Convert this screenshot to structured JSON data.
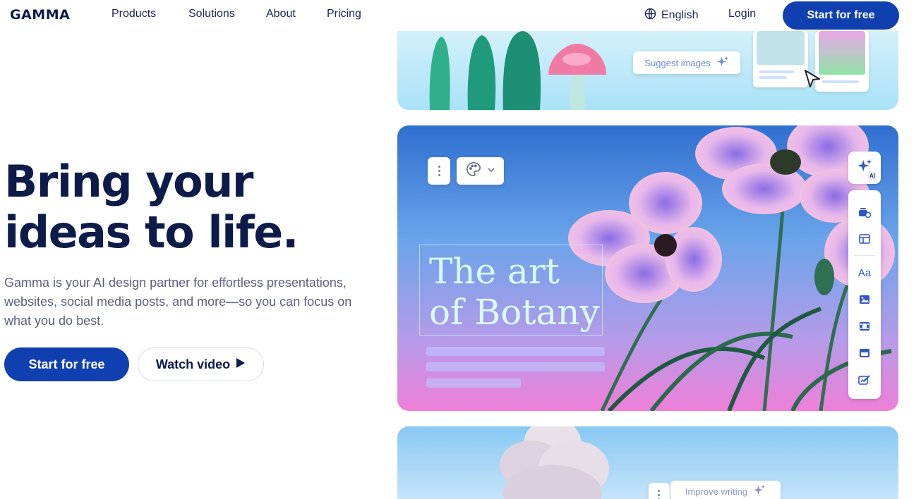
{
  "nav": {
    "logo": "GAMMA",
    "links": [
      "Products",
      "Solutions",
      "About",
      "Pricing"
    ],
    "language": "English",
    "login": "Login",
    "cta": "Start for free"
  },
  "hero": {
    "title_line1": "Bring your",
    "title_line2": "ideas to life.",
    "subtitle": "Gamma is your AI design partner for effortless presentations, websites, social media posts, and more—so you can focus on what you do best.",
    "primary_button": "Start for free",
    "secondary_button": "Watch video"
  },
  "showcase": {
    "suggest_chip": "Suggest images",
    "improve_chip": "Improve writing",
    "card_title_line1": "The art",
    "card_title_line2": "of Botany",
    "ai_badge": "AI",
    "toolbar_text_icon": "Aa"
  },
  "colors": {
    "brand": "#1040b0",
    "heading": "#0d1b4a",
    "body_text": "#5a5f7a",
    "toolbar_icon": "#2f57c9"
  },
  "icons": [
    "globe-icon",
    "play-icon",
    "sparkle-icon",
    "cursor-icon",
    "more-vert-icon",
    "palette-icon",
    "chevron-down-icon",
    "card-add-icon",
    "layout-icon",
    "text-style-icon",
    "image-icon",
    "video-icon",
    "embed-icon",
    "edit-icon"
  ]
}
